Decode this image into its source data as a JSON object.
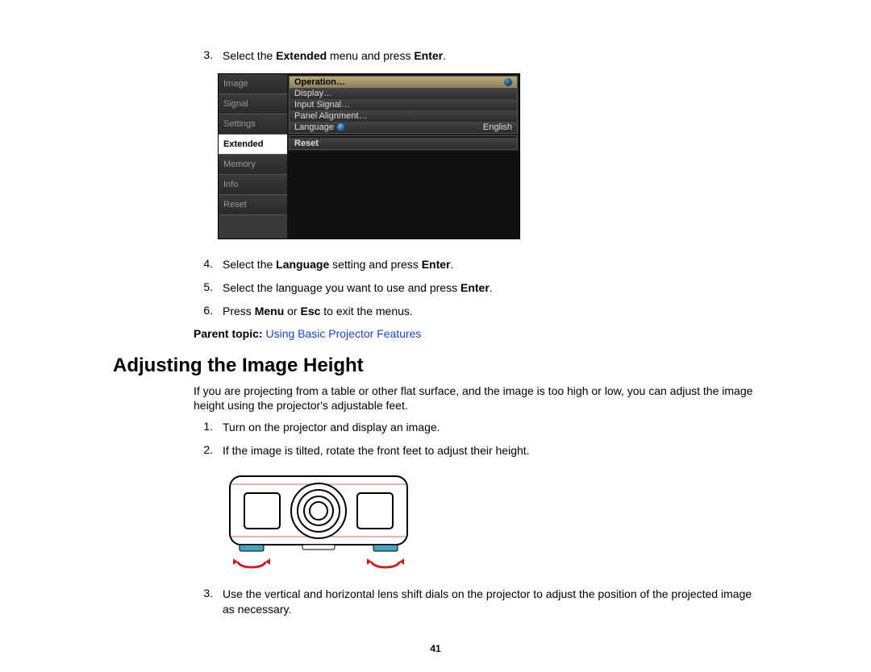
{
  "steps_top": [
    {
      "n": "3.",
      "parts": [
        "Select the ",
        "Extended",
        " menu and press ",
        "Enter",
        "."
      ]
    }
  ],
  "menu": {
    "left": [
      {
        "label": "Image",
        "sel": false
      },
      {
        "label": "Signal",
        "sel": false
      },
      {
        "label": "Settings",
        "sel": false
      },
      {
        "label": "Extended",
        "sel": true
      },
      {
        "label": "Memory",
        "sel": false
      },
      {
        "label": "Info",
        "sel": false
      },
      {
        "label": "Reset",
        "sel": false
      }
    ],
    "right_group": [
      {
        "label": "Operation…",
        "sel": true
      },
      {
        "label": "Display…"
      },
      {
        "label": "Input Signal…"
      },
      {
        "label": "Panel Alignment…"
      },
      {
        "label": "Language",
        "value": "English",
        "lang": true
      }
    ],
    "right_reset": "Reset"
  },
  "steps_mid": [
    {
      "n": "4.",
      "parts": [
        "Select the ",
        "Language",
        " setting and press ",
        "Enter",
        "."
      ]
    },
    {
      "n": "5.",
      "parts_plain_bold_end": {
        "pre": "Select the language you want to use and press ",
        "bold": "Enter",
        "post": "."
      }
    },
    {
      "n": "6.",
      "parts_two_bold": {
        "a": "Press ",
        "b1": "Menu",
        "mid": " or ",
        "b2": "Esc",
        "c": " to exit the menus."
      }
    }
  ],
  "parent_topic": {
    "label": "Parent topic: ",
    "link": "Using Basic Projector Features"
  },
  "section_heading": "Adjusting the Image Height",
  "section_intro": "If you are projecting from a table or other flat surface, and the image is too high or low, you can adjust the image height using the projector's adjustable feet.",
  "steps_bottom": [
    {
      "n": "1.",
      "text": "Turn on the projector and display an image."
    },
    {
      "n": "2.",
      "text": "If the image is tilted, rotate the front feet to adjust their height."
    }
  ],
  "steps_bottom2": [
    {
      "n": "3.",
      "text": "Use the vertical and horizontal lens shift dials on the projector to adjust the position of the projected image as necessary."
    }
  ],
  "page_number": "41"
}
